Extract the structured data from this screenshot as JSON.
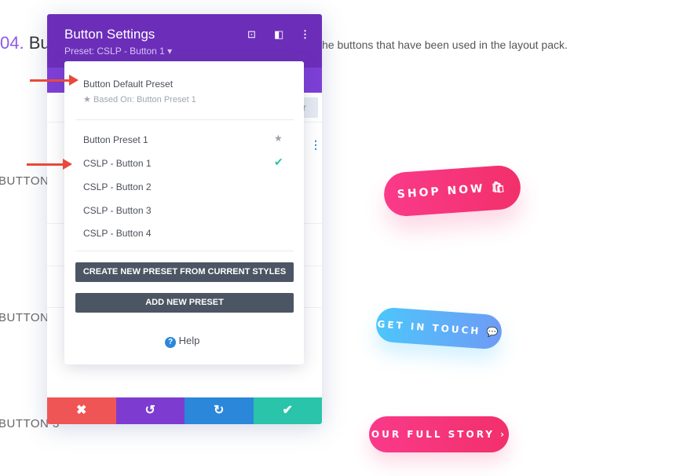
{
  "page": {
    "heading_num": "04.",
    "heading_text": "Bu",
    "description": "he buttons that have been used in the layout pack.",
    "labels": [
      "BUTTON",
      "BUTTON",
      "BUTTON 3"
    ]
  },
  "panel": {
    "title": "Button Settings",
    "preset": "Preset: CSLP - Button 1 ▾",
    "icons": [
      "focus-icon",
      "split-view-icon",
      "more-icon"
    ],
    "filter_label": "er"
  },
  "dropdown": {
    "default_preset": "Button Default Preset",
    "based_on": "Based On: Button Preset 1",
    "items": [
      {
        "label": "Button Preset 1",
        "mark": "star"
      },
      {
        "label": "CSLP - Button 1",
        "mark": "check"
      },
      {
        "label": "CSLP - Button 2"
      },
      {
        "label": "CSLP - Button 3"
      },
      {
        "label": "CSLP - Button 4"
      }
    ],
    "create_label": "CREATE NEW PRESET FROM CURRENT STYLES",
    "add_label": "ADD NEW PRESET",
    "help_label": "Help"
  },
  "footer": {
    "colors": {
      "cancel": "#ef5555",
      "undo": "#7e3bd0",
      "redo": "#2b87da",
      "save": "#29c4a9"
    }
  },
  "preview": {
    "shop": "SHOP NOW",
    "touch": "GET IN TOUCH",
    "story": "OUR FULL STORY ›"
  },
  "colors": {
    "purple": "#6c2eb9",
    "accent_arrow": "#e8493a",
    "check": "#29c4a9"
  }
}
